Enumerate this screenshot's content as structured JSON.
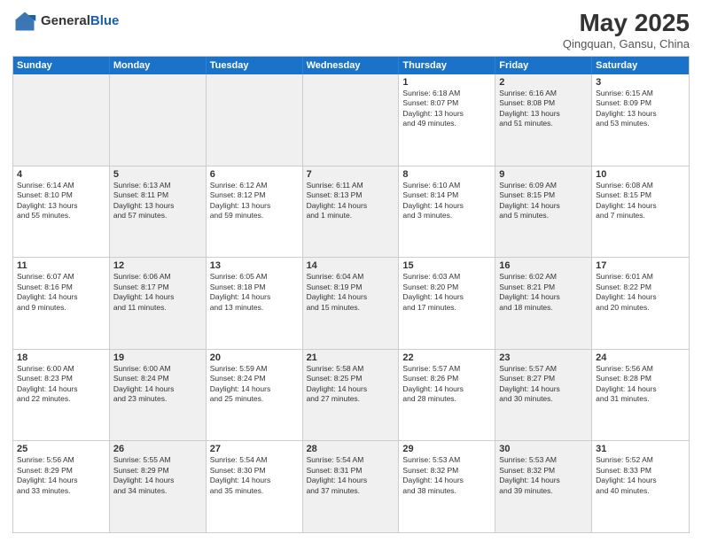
{
  "header": {
    "logo_general": "General",
    "logo_blue": "Blue",
    "title": "May 2025",
    "subtitle": "Qingquan, Gansu, China"
  },
  "days_of_week": [
    "Sunday",
    "Monday",
    "Tuesday",
    "Wednesday",
    "Thursday",
    "Friday",
    "Saturday"
  ],
  "weeks": [
    [
      {
        "day": "",
        "info": "",
        "shaded": true
      },
      {
        "day": "",
        "info": "",
        "shaded": true
      },
      {
        "day": "",
        "info": "",
        "shaded": true
      },
      {
        "day": "",
        "info": "",
        "shaded": true
      },
      {
        "day": "1",
        "info": "Sunrise: 6:18 AM\nSunset: 8:07 PM\nDaylight: 13 hours\nand 49 minutes.",
        "shaded": false
      },
      {
        "day": "2",
        "info": "Sunrise: 6:16 AM\nSunset: 8:08 PM\nDaylight: 13 hours\nand 51 minutes.",
        "shaded": true
      },
      {
        "day": "3",
        "info": "Sunrise: 6:15 AM\nSunset: 8:09 PM\nDaylight: 13 hours\nand 53 minutes.",
        "shaded": false
      }
    ],
    [
      {
        "day": "4",
        "info": "Sunrise: 6:14 AM\nSunset: 8:10 PM\nDaylight: 13 hours\nand 55 minutes.",
        "shaded": false
      },
      {
        "day": "5",
        "info": "Sunrise: 6:13 AM\nSunset: 8:11 PM\nDaylight: 13 hours\nand 57 minutes.",
        "shaded": true
      },
      {
        "day": "6",
        "info": "Sunrise: 6:12 AM\nSunset: 8:12 PM\nDaylight: 13 hours\nand 59 minutes.",
        "shaded": false
      },
      {
        "day": "7",
        "info": "Sunrise: 6:11 AM\nSunset: 8:13 PM\nDaylight: 14 hours\nand 1 minute.",
        "shaded": true
      },
      {
        "day": "8",
        "info": "Sunrise: 6:10 AM\nSunset: 8:14 PM\nDaylight: 14 hours\nand 3 minutes.",
        "shaded": false
      },
      {
        "day": "9",
        "info": "Sunrise: 6:09 AM\nSunset: 8:15 PM\nDaylight: 14 hours\nand 5 minutes.",
        "shaded": true
      },
      {
        "day": "10",
        "info": "Sunrise: 6:08 AM\nSunset: 8:15 PM\nDaylight: 14 hours\nand 7 minutes.",
        "shaded": false
      }
    ],
    [
      {
        "day": "11",
        "info": "Sunrise: 6:07 AM\nSunset: 8:16 PM\nDaylight: 14 hours\nand 9 minutes.",
        "shaded": false
      },
      {
        "day": "12",
        "info": "Sunrise: 6:06 AM\nSunset: 8:17 PM\nDaylight: 14 hours\nand 11 minutes.",
        "shaded": true
      },
      {
        "day": "13",
        "info": "Sunrise: 6:05 AM\nSunset: 8:18 PM\nDaylight: 14 hours\nand 13 minutes.",
        "shaded": false
      },
      {
        "day": "14",
        "info": "Sunrise: 6:04 AM\nSunset: 8:19 PM\nDaylight: 14 hours\nand 15 minutes.",
        "shaded": true
      },
      {
        "day": "15",
        "info": "Sunrise: 6:03 AM\nSunset: 8:20 PM\nDaylight: 14 hours\nand 17 minutes.",
        "shaded": false
      },
      {
        "day": "16",
        "info": "Sunrise: 6:02 AM\nSunset: 8:21 PM\nDaylight: 14 hours\nand 18 minutes.",
        "shaded": true
      },
      {
        "day": "17",
        "info": "Sunrise: 6:01 AM\nSunset: 8:22 PM\nDaylight: 14 hours\nand 20 minutes.",
        "shaded": false
      }
    ],
    [
      {
        "day": "18",
        "info": "Sunrise: 6:00 AM\nSunset: 8:23 PM\nDaylight: 14 hours\nand 22 minutes.",
        "shaded": false
      },
      {
        "day": "19",
        "info": "Sunrise: 6:00 AM\nSunset: 8:24 PM\nDaylight: 14 hours\nand 23 minutes.",
        "shaded": true
      },
      {
        "day": "20",
        "info": "Sunrise: 5:59 AM\nSunset: 8:24 PM\nDaylight: 14 hours\nand 25 minutes.",
        "shaded": false
      },
      {
        "day": "21",
        "info": "Sunrise: 5:58 AM\nSunset: 8:25 PM\nDaylight: 14 hours\nand 27 minutes.",
        "shaded": true
      },
      {
        "day": "22",
        "info": "Sunrise: 5:57 AM\nSunset: 8:26 PM\nDaylight: 14 hours\nand 28 minutes.",
        "shaded": false
      },
      {
        "day": "23",
        "info": "Sunrise: 5:57 AM\nSunset: 8:27 PM\nDaylight: 14 hours\nand 30 minutes.",
        "shaded": true
      },
      {
        "day": "24",
        "info": "Sunrise: 5:56 AM\nSunset: 8:28 PM\nDaylight: 14 hours\nand 31 minutes.",
        "shaded": false
      }
    ],
    [
      {
        "day": "25",
        "info": "Sunrise: 5:56 AM\nSunset: 8:29 PM\nDaylight: 14 hours\nand 33 minutes.",
        "shaded": false
      },
      {
        "day": "26",
        "info": "Sunrise: 5:55 AM\nSunset: 8:29 PM\nDaylight: 14 hours\nand 34 minutes.",
        "shaded": true
      },
      {
        "day": "27",
        "info": "Sunrise: 5:54 AM\nSunset: 8:30 PM\nDaylight: 14 hours\nand 35 minutes.",
        "shaded": false
      },
      {
        "day": "28",
        "info": "Sunrise: 5:54 AM\nSunset: 8:31 PM\nDaylight: 14 hours\nand 37 minutes.",
        "shaded": true
      },
      {
        "day": "29",
        "info": "Sunrise: 5:53 AM\nSunset: 8:32 PM\nDaylight: 14 hours\nand 38 minutes.",
        "shaded": false
      },
      {
        "day": "30",
        "info": "Sunrise: 5:53 AM\nSunset: 8:32 PM\nDaylight: 14 hours\nand 39 minutes.",
        "shaded": true
      },
      {
        "day": "31",
        "info": "Sunrise: 5:52 AM\nSunset: 8:33 PM\nDaylight: 14 hours\nand 40 minutes.",
        "shaded": false
      }
    ]
  ]
}
